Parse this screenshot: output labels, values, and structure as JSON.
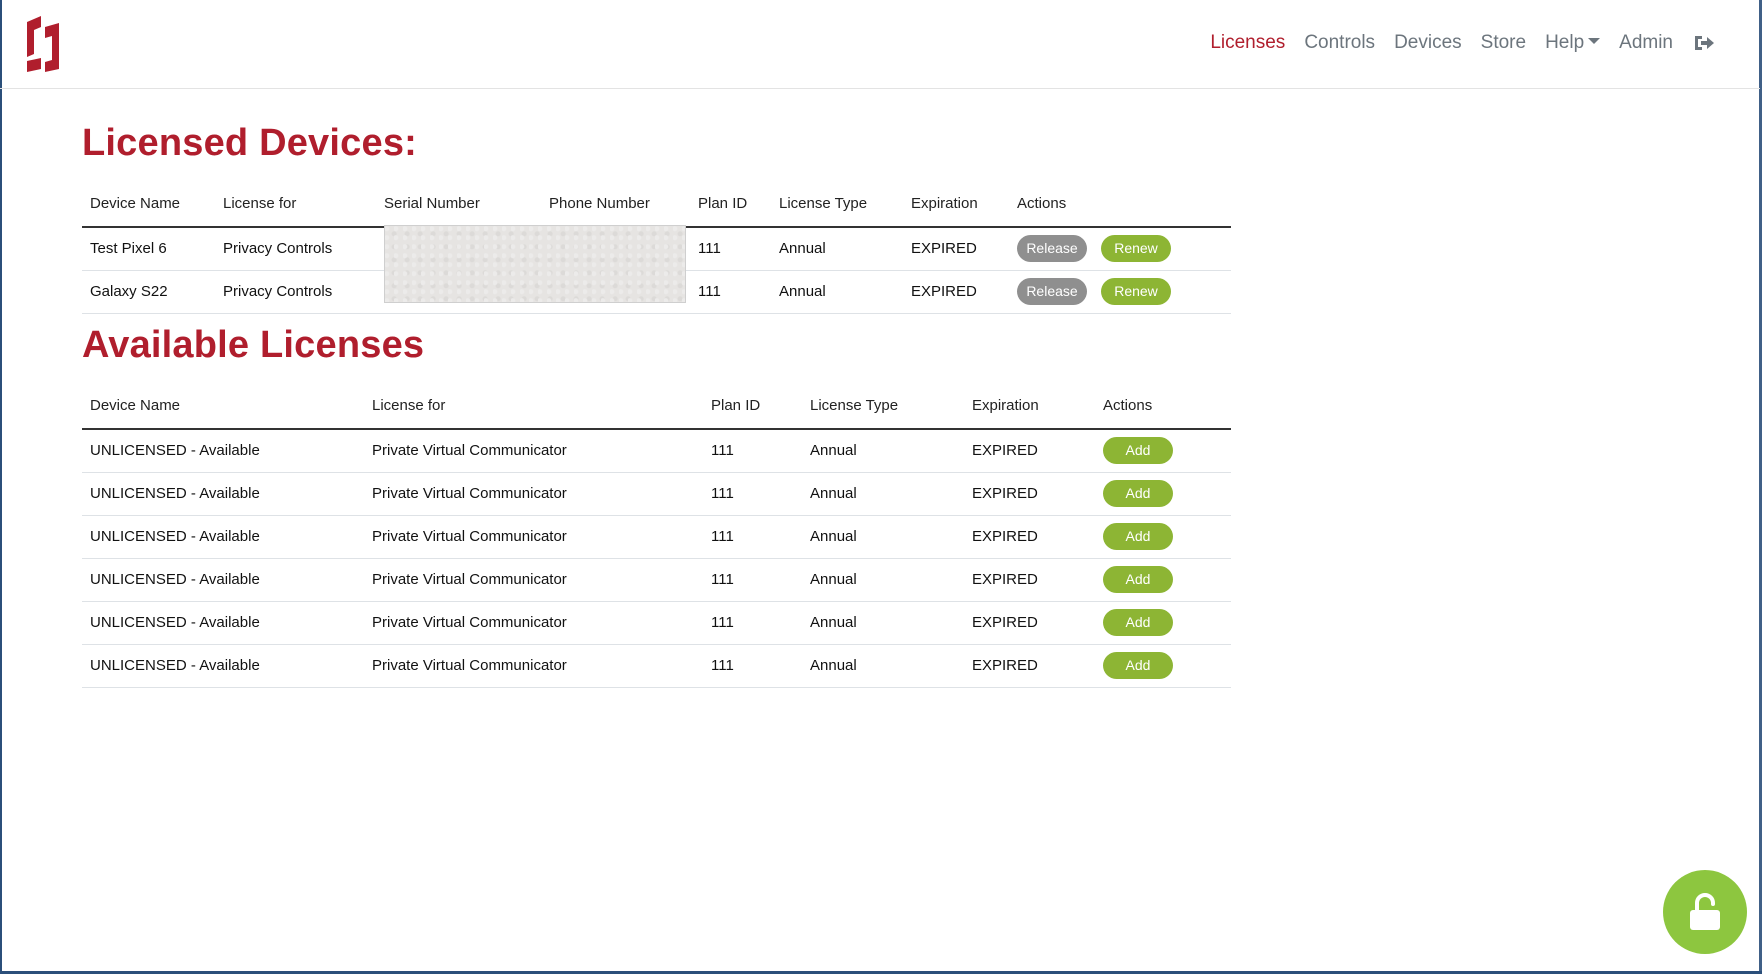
{
  "nav": {
    "items": [
      {
        "label": "Licenses",
        "active": true
      },
      {
        "label": "Controls",
        "active": false
      },
      {
        "label": "Devices",
        "active": false
      },
      {
        "label": "Store",
        "active": false
      },
      {
        "label": "Help",
        "active": false,
        "dropdown": true
      },
      {
        "label": "Admin",
        "active": false
      }
    ],
    "logout_icon": "sign-out-icon"
  },
  "licensed": {
    "title": "Licensed Devices:",
    "headers": [
      "Device Name",
      "License for",
      "Serial Number",
      "Phone Number",
      "Plan ID",
      "License Type",
      "Expiration",
      "Actions"
    ],
    "rows": [
      {
        "device": "Test Pixel 6",
        "license_for": "Privacy Controls",
        "plan_id": "111",
        "type": "Annual",
        "expiration": "EXPIRED"
      },
      {
        "device": "Galaxy S22",
        "license_for": "Privacy Controls",
        "plan_id": "111",
        "type": "Annual",
        "expiration": "EXPIRED"
      }
    ],
    "release_label": "Release",
    "renew_label": "Renew"
  },
  "available": {
    "title": "Available Licenses",
    "headers": [
      "Device Name",
      "License for",
      "Plan ID",
      "License Type",
      "Expiration",
      "Actions"
    ],
    "rows": [
      {
        "device": "UNLICENSED - Available",
        "license_for": "Private Virtual Communicator",
        "plan_id": "111",
        "type": "Annual",
        "expiration": "EXPIRED"
      },
      {
        "device": "UNLICENSED - Available",
        "license_for": "Private Virtual Communicator",
        "plan_id": "111",
        "type": "Annual",
        "expiration": "EXPIRED"
      },
      {
        "device": "UNLICENSED - Available",
        "license_for": "Private Virtual Communicator",
        "plan_id": "111",
        "type": "Annual",
        "expiration": "EXPIRED"
      },
      {
        "device": "UNLICENSED - Available",
        "license_for": "Private Virtual Communicator",
        "plan_id": "111",
        "type": "Annual",
        "expiration": "EXPIRED"
      },
      {
        "device": "UNLICENSED - Available",
        "license_for": "Private Virtual Communicator",
        "plan_id": "111",
        "type": "Annual",
        "expiration": "EXPIRED"
      },
      {
        "device": "UNLICENSED - Available",
        "license_for": "Private Virtual Communicator",
        "plan_id": "111",
        "type": "Annual",
        "expiration": "EXPIRED"
      }
    ],
    "add_label": "Add"
  },
  "colors": {
    "brand_red": "#b01e2d",
    "green": "#8db534",
    "gray": "#8f8f8f",
    "fab_green": "#8dc63f"
  },
  "fab_icon": "unlock-icon"
}
